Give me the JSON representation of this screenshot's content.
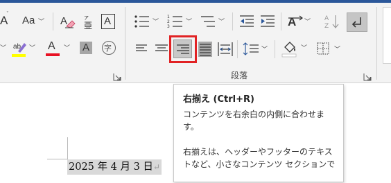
{
  "ribbon": {
    "font_group": {
      "font_size_icon": "font-size-icon",
      "change_case_label": "Aa",
      "clear_format_icon": "clear-formatting-icon",
      "char_border_label": "A",
      "partial_label": "A",
      "highlight_label": "ab",
      "font_color_label": "A",
      "char_shading_label": "A",
      "enclose_char_label": "字"
    },
    "paragraph_group": {
      "label": "段落",
      "align_right_selected": true
    },
    "colors": {
      "accent": "#2b579a",
      "highlight_box": "#e12224",
      "font_color_bar": "#e81123",
      "highlight_bar": "#ffff00"
    }
  },
  "tooltip": {
    "title": "右揃え (Ctrl+R)",
    "para1": "コンテンツを右余白の内側に合わせます。",
    "para2": "右揃えは、ヘッダーやフッターのテキストなど、小さなコンテンツ セクションで"
  },
  "document": {
    "date_text": "2025 年 4 月 3 日",
    "paragraph_mark": "↵"
  }
}
